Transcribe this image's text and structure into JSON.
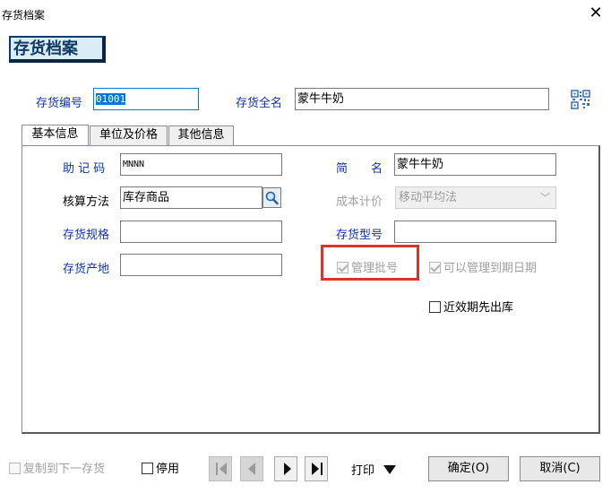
{
  "window": {
    "title": "存货档案",
    "close_glyph": "✕"
  },
  "header": {
    "badge": "存货档案"
  },
  "top_fields": {
    "code_label": "存货编号",
    "code_value": "01001",
    "fullname_label": "存货全名",
    "fullname_value": "蒙牛牛奶",
    "qr_icon": "qr-code-icon"
  },
  "tabs": [
    {
      "label": "基本信息",
      "active": true
    },
    {
      "label": "单位及价格",
      "active": false
    },
    {
      "label": "其他信息",
      "active": false
    }
  ],
  "form": {
    "mnemonic_label": "助 记 码",
    "mnemonic_value": "MNNN",
    "short_name_label": "简　　名",
    "short_name_value": "蒙牛牛奶",
    "accounting_label": "核算方法",
    "accounting_value": "库存商品",
    "cost_label": "成本计价",
    "cost_value": "移动平均法",
    "spec_label": "存货规格",
    "spec_value": "",
    "model_label": "存货型号",
    "model_value": "",
    "origin_label": "存货产地",
    "origin_value": "",
    "batch_label": "管理批号",
    "batch_checked": true,
    "expiry_label": "可以管理到期日期",
    "expiry_checked": true,
    "fefo_label": "近效期先出库",
    "fefo_checked": false
  },
  "footer": {
    "copy_label": "复制到下一存货",
    "disable_label": "停用",
    "print_label": "打印",
    "ok_label": "确定(O)",
    "cancel_label": "取消(C)"
  },
  "colors": {
    "label_blue": "#1133aa",
    "badge_bg": "#d9ecf7",
    "badge_text": "#0f3a63",
    "highlight_red": "#d9342b",
    "selection_blue": "#0078d7"
  }
}
